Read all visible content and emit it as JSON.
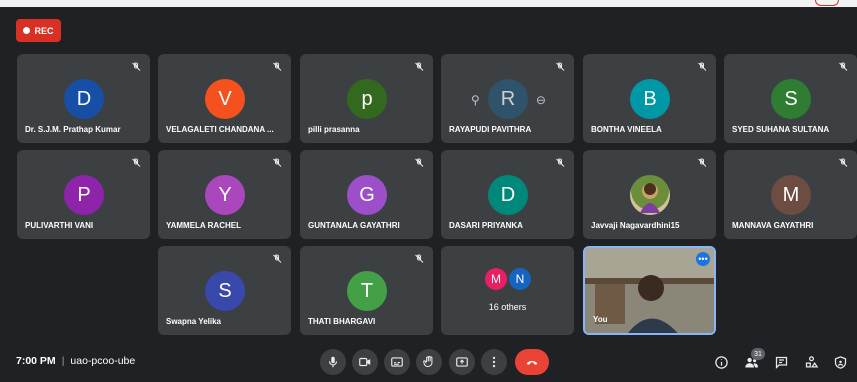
{
  "recording": {
    "label": "REC"
  },
  "participants": [
    {
      "initial": "D",
      "name": "Dr. S.J.M. Prathap Kumar",
      "color": "#174ea6"
    },
    {
      "initial": "V",
      "name": "VELAGALETI CHANDANA ...",
      "color": "#f4511e"
    },
    {
      "initial": "p",
      "name": "pilli prasanna",
      "color": "#33691e"
    },
    {
      "initial": "R",
      "name": "RAYAPUDI PAVITHRA",
      "color": "#2b5a78"
    },
    {
      "initial": "B",
      "name": "BONTHA VINEELA",
      "color": "#0097a7"
    },
    {
      "initial": "S",
      "name": "SYED SUHANA SULTANA",
      "color": "#2e7d32"
    },
    {
      "initial": "P",
      "name": "PULIVARTHI VANI",
      "color": "#8e24aa"
    },
    {
      "initial": "Y",
      "name": "YAMMELA RACHEL",
      "color": "#ab47bc"
    },
    {
      "initial": "G",
      "name": "GUNTANALA GAYATHRI",
      "color": "#9c4fc9"
    },
    {
      "initial": "D",
      "name": "DASARI PRIYANKA",
      "color": "#00897b"
    },
    {
      "initial": "",
      "name": "Javvaji Nagavardhini15",
      "color": "#7cb342"
    },
    {
      "initial": "M",
      "name": "MANNAVA GAYATHRI",
      "color": "#6d4c41"
    },
    {
      "initial": "S",
      "name": "Swapna Yelika",
      "color": "#3949ab"
    },
    {
      "initial": "T",
      "name": "THATI BHARGAVI",
      "color": "#43a047"
    }
  ],
  "others": {
    "count_label": "16 others",
    "avatars": [
      {
        "initial": "M",
        "color": "#e91e63"
      },
      {
        "initial": "N",
        "color": "#1565c0"
      }
    ]
  },
  "self_tile": {
    "name": "You"
  },
  "meeting": {
    "time": "7:00 PM",
    "separator": "|",
    "code": "uao-pcoo-ube"
  },
  "participant_count": "31",
  "controls": [
    "mic-icon",
    "camera-icon",
    "captions-icon",
    "raise-hand-icon",
    "present-icon",
    "more-options-icon",
    "leave-call-icon"
  ],
  "right_icons": [
    "info-icon",
    "people-icon",
    "chat-icon",
    "activities-icon",
    "host-controls-icon"
  ]
}
